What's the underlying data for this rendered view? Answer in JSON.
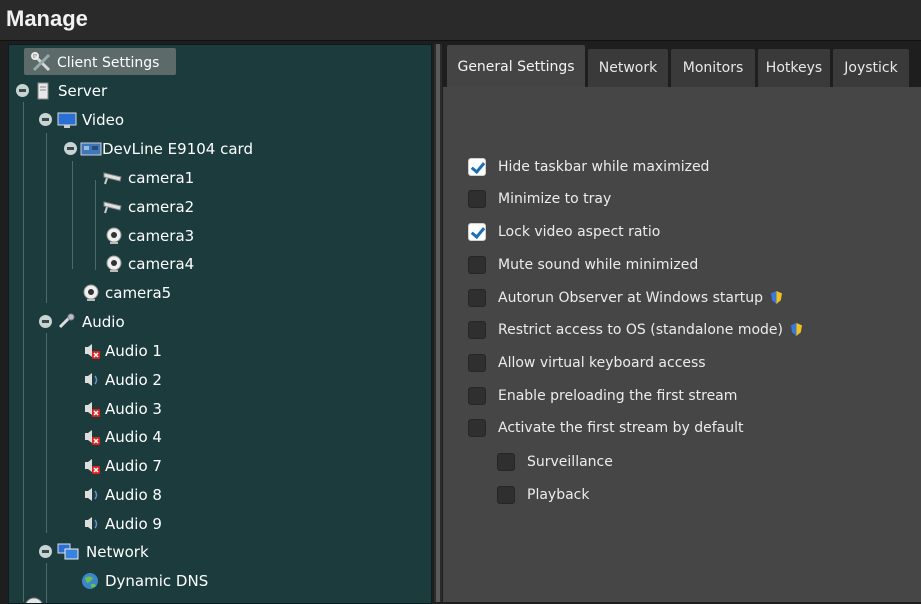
{
  "window": {
    "title": "Manage"
  },
  "tree": {
    "client_settings": "Client Settings",
    "server": "Server",
    "video": "Video",
    "devline": "DevLine E9104 card",
    "camera1": "camera1",
    "camera2": "camera2",
    "camera3": "camera3",
    "camera4": "camera4",
    "camera5": "camera5",
    "audio": "Audio",
    "audio1": "Audio 1",
    "audio2": "Audio 2",
    "audio3": "Audio 3",
    "audio4": "Audio 4",
    "audio7": "Audio 7",
    "audio8": "Audio 8",
    "audio9": "Audio 9",
    "network": "Network",
    "dynamic_dns": "Dynamic DNS"
  },
  "tabs": {
    "general": "General Settings",
    "network": "Network",
    "monitors": "Monitors",
    "hotkeys": "Hotkeys",
    "joystick": "Joystick"
  },
  "options": {
    "hide_taskbar": {
      "label": "Hide taskbar while maximized",
      "checked": true
    },
    "minimize_tray": {
      "label": "Minimize to tray",
      "checked": false
    },
    "lock_aspect": {
      "label": "Lock video aspect ratio",
      "checked": true
    },
    "mute_sound": {
      "label": "Mute sound while minimized",
      "checked": false
    },
    "autorun": {
      "label": "Autorun Observer at Windows startup",
      "checked": false
    },
    "restrict_os": {
      "label": "Restrict access to OS (standalone mode)",
      "checked": false
    },
    "virtual_kb": {
      "label": "Allow virtual keyboard access",
      "checked": false
    },
    "preload_stream": {
      "label": "Enable preloading the first stream",
      "checked": false
    },
    "activate_stream": {
      "label": "Activate the first stream by default",
      "checked": false
    },
    "surveillance": {
      "label": "Surveillance",
      "checked": false
    },
    "playback": {
      "label": "Playback",
      "checked": false
    }
  },
  "colors": {
    "tree_bg": "#1b3b3d",
    "content_bg": "#464646",
    "check_accent": "#1a6fb5"
  }
}
